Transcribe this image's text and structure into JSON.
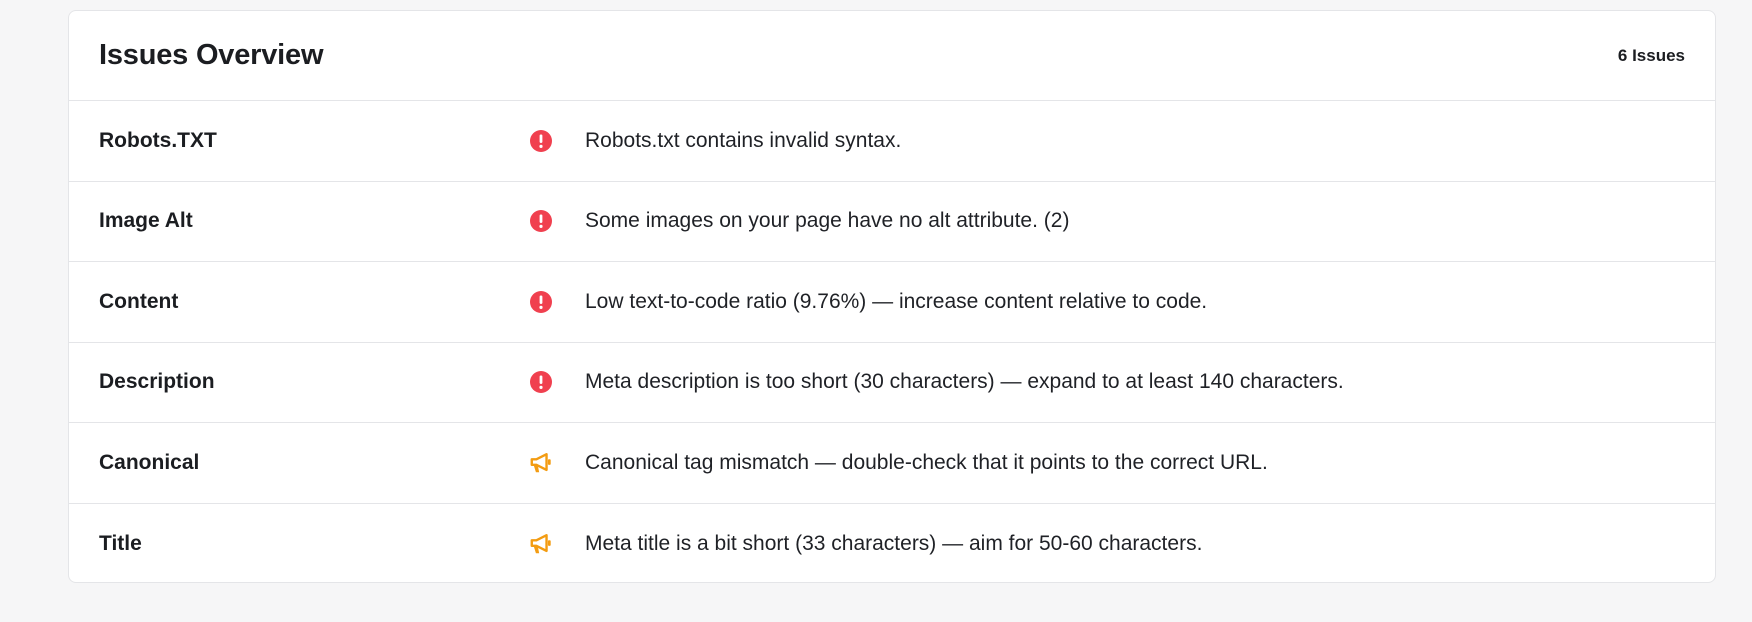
{
  "header": {
    "title": "Issues Overview",
    "count": "6 Issues"
  },
  "colors": {
    "error": "#f0404f",
    "warning": "#f39c12"
  },
  "issues": [
    {
      "name": "Robots.TXT",
      "icon": "error-icon",
      "message": "Robots.txt contains invalid syntax."
    },
    {
      "name": "Image Alt",
      "icon": "error-icon",
      "message": "Some images on your page have no alt attribute. (2)"
    },
    {
      "name": "Content",
      "icon": "error-icon",
      "message": "Low text-to-code ratio (9.76%) — increase content relative to code."
    },
    {
      "name": "Description",
      "icon": "error-icon",
      "message": "Meta description is too short (30 characters) — expand to at least 140 characters."
    },
    {
      "name": "Canonical",
      "icon": "megaphone-icon",
      "message": "Canonical tag mismatch — double-check that it points to the correct URL."
    },
    {
      "name": "Title",
      "icon": "megaphone-icon",
      "message": "Meta title is a bit short (33 characters) — aim for 50-60 characters."
    }
  ]
}
